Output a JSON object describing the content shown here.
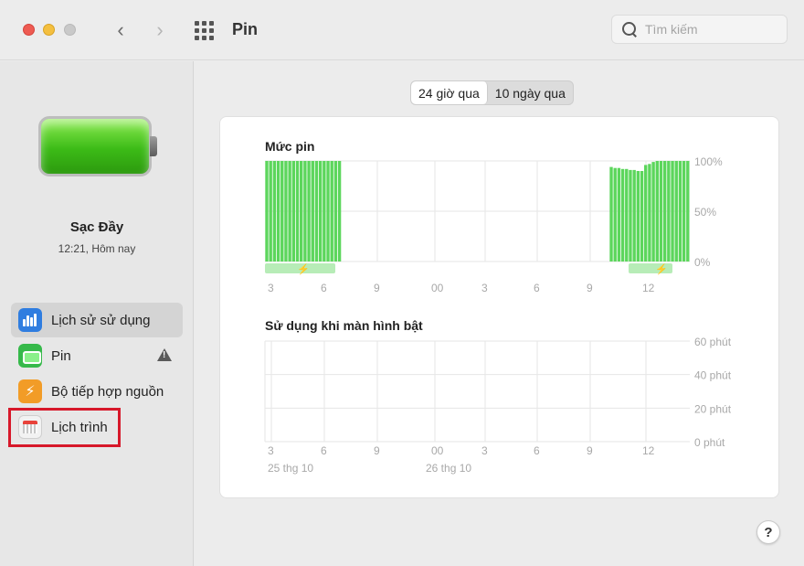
{
  "window": {
    "title": "Pin",
    "search_placeholder": "Tìm kiếm"
  },
  "sidebar": {
    "status_title": "Sạc Đầy",
    "status_time": "12:21, Hôm nay",
    "items": [
      {
        "label": "Lịch sử sử dụng",
        "icon": "usage-history-icon",
        "active": true
      },
      {
        "label": "Pin",
        "icon": "battery-icon",
        "warning": true
      },
      {
        "label": "Bộ tiếp hợp nguồn",
        "icon": "power-adapter-icon"
      },
      {
        "label": "Lịch trình",
        "icon": "schedule-icon",
        "highlighted": true
      }
    ]
  },
  "tabs": [
    {
      "label": "24 giờ qua",
      "selected": true
    },
    {
      "label": "10 ngày qua",
      "selected": false
    }
  ],
  "help_label": "?",
  "colors": {
    "bar_green": "#5cd65c",
    "charging_strip": "#b7ecb7",
    "highlight_red": "#d7182a"
  },
  "chart_data": [
    {
      "type": "bar",
      "title": "Mức pin",
      "y_ticks": [
        "100%",
        "50%",
        "0%"
      ],
      "ylim": [
        0,
        100
      ],
      "x_ticks": [
        "3",
        "6",
        "9",
        "00",
        "3",
        "6",
        "9",
        "12"
      ],
      "series": [
        {
          "values": [
            100,
            100,
            100,
            100,
            100,
            100,
            100,
            100,
            100,
            100,
            100,
            100,
            100,
            100,
            100,
            100,
            100,
            100,
            100,
            100,
            0,
            0,
            0,
            0,
            0,
            0,
            0,
            0,
            0,
            0,
            0,
            0,
            0,
            0,
            0,
            0,
            0,
            0,
            0,
            0,
            0,
            0,
            0,
            0,
            0,
            0,
            0,
            0,
            0,
            0,
            0,
            0,
            0,
            0,
            0,
            0,
            0,
            0,
            0,
            0,
            0,
            0,
            0,
            0,
            0,
            0,
            0,
            0,
            0,
            0,
            0,
            0,
            0,
            0,
            0,
            0,
            0,
            0,
            0,
            0,
            0,
            0,
            0,
            0,
            0,
            0,
            0,
            0,
            0,
            0,
            94,
            93,
            93,
            92,
            92,
            91,
            91,
            90,
            90,
            96,
            97,
            99,
            100,
            100,
            100,
            100,
            100,
            100,
            100,
            100,
            100
          ]
        }
      ],
      "charging_strip": "🗲"
    },
    {
      "type": "bar",
      "title": "Sử dụng khi màn hình bật",
      "y_ticks": [
        "60 phút",
        "40 phút",
        "20 phút",
        "0 phút"
      ],
      "ylim": [
        0,
        60
      ],
      "x_ticks": [
        "3",
        "6",
        "9",
        "00",
        "3",
        "6",
        "9",
        "12"
      ],
      "date_labels": [
        "25 thg 10",
        "26 thg 10"
      ],
      "series": [
        {
          "values": []
        }
      ]
    }
  ]
}
